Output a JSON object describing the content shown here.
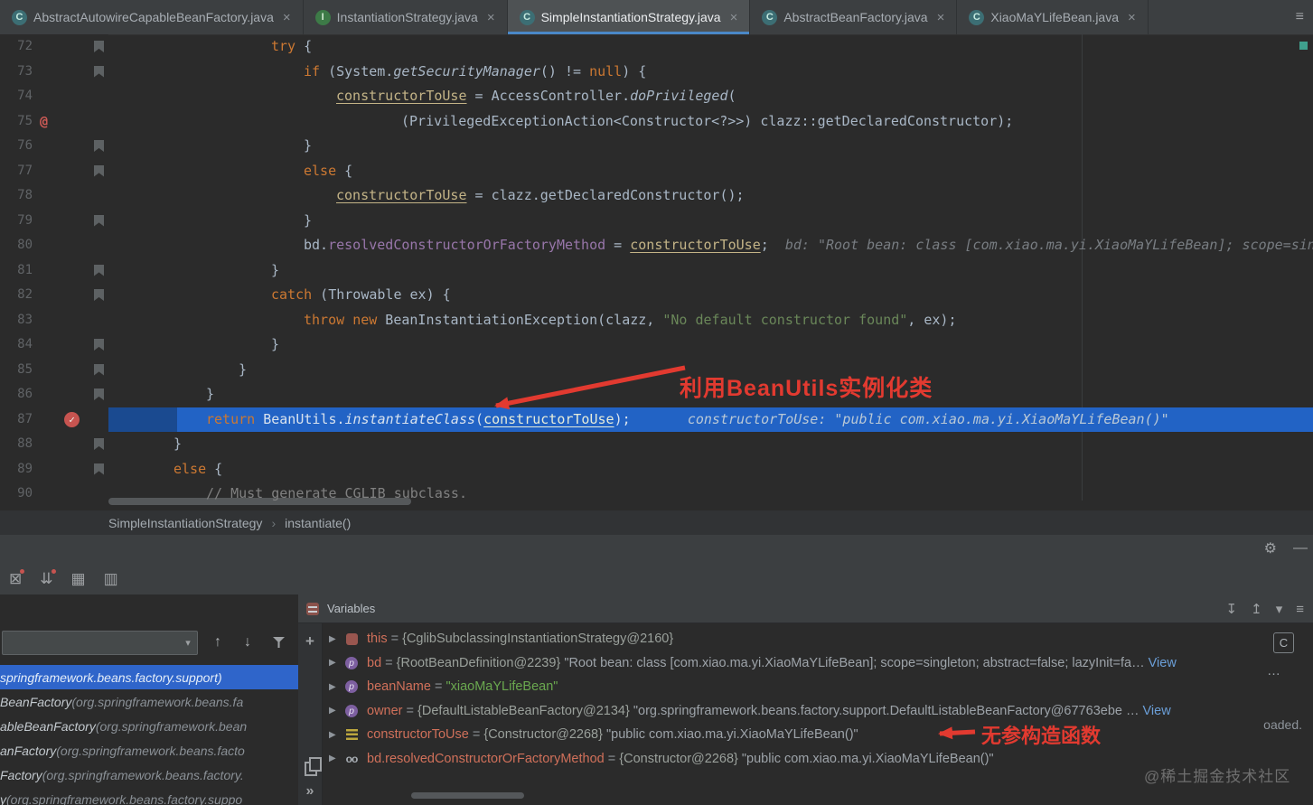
{
  "icons": {
    "overflow": "≡",
    "dropdown": "▾",
    "close": "×",
    "check": "✓",
    "at": "@",
    "gear": "⚙",
    "minus": "—",
    "plus": "+",
    "chevrons": "»",
    "up": "↑",
    "down": "↓",
    "triangle": "▶"
  },
  "tabs": {
    "items": [
      {
        "label": "AbstractAutowireCapableBeanFactory.java",
        "icon": "C",
        "kind": "class",
        "active": false
      },
      {
        "label": "InstantiationStrategy.java",
        "icon": "I",
        "kind": "interface",
        "active": false
      },
      {
        "label": "SimpleInstantiationStrategy.java",
        "icon": "C",
        "kind": "class",
        "active": true
      },
      {
        "label": "AbstractBeanFactory.java",
        "icon": "C",
        "kind": "class",
        "active": false
      },
      {
        "label": "XiaoMaYLifeBean.java",
        "icon": "C",
        "kind": "class",
        "active": false
      }
    ]
  },
  "editor": {
    "current_line": 87,
    "lines": [
      {
        "no": 72,
        "ind": 5,
        "g": "bm",
        "seg": [
          [
            "kw",
            "try"
          ],
          [
            "pl",
            " {"
          ]
        ]
      },
      {
        "no": 73,
        "ind": 6,
        "g": "bm",
        "seg": [
          [
            "kw",
            "if"
          ],
          [
            "pl",
            " (System."
          ],
          [
            "it",
            "getSecurityManager"
          ],
          [
            "pl",
            "() != "
          ],
          [
            "kw",
            "null"
          ],
          [
            "pl",
            ") {"
          ]
        ]
      },
      {
        "no": 74,
        "ind": 7,
        "g": "",
        "seg": [
          [
            "un",
            "constructorToUse"
          ],
          [
            "pl",
            " = AccessController."
          ],
          [
            "it",
            "doPrivileged"
          ],
          [
            "pl",
            "("
          ]
        ]
      },
      {
        "no": 75,
        "ind": 9,
        "g": "at",
        "seg": [
          [
            "pl",
            "(PrivilegedExceptionAction<Constructor<?>>) clazz::getDeclaredConstructor);"
          ]
        ]
      },
      {
        "no": 76,
        "ind": 6,
        "g": "bm",
        "seg": [
          [
            "pl",
            "}"
          ]
        ]
      },
      {
        "no": 77,
        "ind": 6,
        "g": "bm",
        "seg": [
          [
            "kw",
            "else"
          ],
          [
            "pl",
            " {"
          ]
        ]
      },
      {
        "no": 78,
        "ind": 7,
        "g": "",
        "seg": [
          [
            "un",
            "constructorToUse"
          ],
          [
            "pl",
            " = clazz.getDeclaredConstructor();"
          ]
        ]
      },
      {
        "no": 79,
        "ind": 6,
        "g": "bm",
        "seg": [
          [
            "pl",
            "}"
          ]
        ]
      },
      {
        "no": 80,
        "ind": 6,
        "g": "",
        "seg": [
          [
            "pl",
            "bd."
          ],
          [
            "fld",
            "resolvedConstructorOrFactoryMethod"
          ],
          [
            "pl",
            " = "
          ],
          [
            "un",
            "constructorToUse"
          ],
          [
            "pl",
            ";"
          ],
          [
            "hint",
            "  bd: \"Root bean: class [com.xiao.ma.yi.XiaoMaYLifeBean]; scope=sin"
          ]
        ]
      },
      {
        "no": 81,
        "ind": 5,
        "g": "bm",
        "seg": [
          [
            "pl",
            "}"
          ]
        ]
      },
      {
        "no": 82,
        "ind": 5,
        "g": "bm",
        "seg": [
          [
            "kw",
            "catch"
          ],
          [
            "pl",
            " (Throwable ex) {"
          ]
        ]
      },
      {
        "no": 83,
        "ind": 6,
        "g": "",
        "seg": [
          [
            "kw",
            "throw"
          ],
          [
            "pl",
            " "
          ],
          [
            "kw",
            "new"
          ],
          [
            "pl",
            " BeanInstantiationException(clazz, "
          ],
          [
            "str",
            "\"No default constructor found\""
          ],
          [
            "pl",
            ", ex);"
          ]
        ]
      },
      {
        "no": 84,
        "ind": 5,
        "g": "bm",
        "seg": [
          [
            "pl",
            "}"
          ]
        ]
      },
      {
        "no": 85,
        "ind": 4,
        "g": "bm",
        "seg": [
          [
            "pl",
            "}"
          ]
        ]
      },
      {
        "no": 86,
        "ind": 3,
        "g": "bm",
        "seg": [
          [
            "pl",
            "}"
          ]
        ]
      },
      {
        "no": 87,
        "ind": 3,
        "g": "bp",
        "seg": [
          [
            "kw",
            "return"
          ],
          [
            "pl",
            " BeanUtils."
          ],
          [
            "it",
            "instantiateClass"
          ],
          [
            "pl",
            "("
          ],
          [
            "un",
            "constructorToUse"
          ],
          [
            "pl",
            ");"
          ],
          [
            "hint2",
            "       constructorToUse: \"public com.xiao.ma.yi.XiaoMaYLifeBean()\""
          ]
        ]
      },
      {
        "no": 88,
        "ind": 2,
        "g": "bm",
        "seg": [
          [
            "pl",
            "}"
          ]
        ]
      },
      {
        "no": 89,
        "ind": 2,
        "g": "bm",
        "seg": [
          [
            "kw",
            "else"
          ],
          [
            "pl",
            " {"
          ]
        ]
      },
      {
        "no": 90,
        "ind": 3,
        "g": "",
        "seg": [
          [
            "cmt",
            "// Must generate CGLIB subclass."
          ]
        ]
      }
    ],
    "breadcrumb": {
      "items": [
        "SimpleInstantiationStrategy",
        "instantiate()"
      ],
      "separator": "›"
    }
  },
  "debug": {
    "toolbar_icons": [
      {
        "name": "close-tab-icon",
        "glyph": "⊠",
        "red": true
      },
      {
        "name": "step-filter-icon",
        "glyph": "⇊",
        "red": true
      },
      {
        "name": "view-as-table-icon",
        "glyph": "▦",
        "red": false
      },
      {
        "name": "layout-settings-icon",
        "glyph": "▥",
        "red": false
      }
    ]
  },
  "frames": {
    "combo_value": "",
    "rows": [
      {
        "sel": true,
        "head": "",
        "pkg": "springframework.beans.factory.support)"
      },
      {
        "sel": false,
        "head": "BeanFactory ",
        "pkg": "(org.springframework.beans.fa"
      },
      {
        "sel": false,
        "head": "ableBeanFactory ",
        "pkg": "(org.springframework.bean"
      },
      {
        "sel": false,
        "head": "anFactory ",
        "pkg": "(org.springframework.beans.facto"
      },
      {
        "sel": false,
        "head": "Factory ",
        "pkg": "(org.springframework.beans.factory."
      },
      {
        "sel": false,
        "head": "y ",
        "pkg": "(org.springframework.beans.factory.suppo"
      }
    ]
  },
  "variables": {
    "title": "Variables",
    "header_icons": [
      {
        "name": "scroll-to-end-icon",
        "glyph": "↧"
      },
      {
        "name": "jump-to-source-icon",
        "glyph": "↥"
      },
      {
        "name": "menu-arrow-icon",
        "glyph": "▾"
      },
      {
        "name": "menu-icon",
        "glyph": "≡"
      }
    ],
    "rows": [
      {
        "icon": "object",
        "seg": [
          [
            "vn",
            "this"
          ],
          [
            "eq",
            " = "
          ],
          [
            "ref",
            "{CglibSubclassingInstantiationStrategy@2160}"
          ]
        ]
      },
      {
        "icon": "param",
        "seg": [
          [
            "vn",
            "bd"
          ],
          [
            "eq",
            " = "
          ],
          [
            "ref",
            "{RootBeanDefinition@2239} "
          ],
          [
            "gs",
            "\"Root bean: class [com.xiao.ma.yi.XiaoMaYLifeBean]; scope=singleton; abstract=false; lazyInit=fa"
          ],
          [
            "ell",
            "… "
          ],
          [
            "view",
            "View"
          ]
        ]
      },
      {
        "icon": "param",
        "seg": [
          [
            "vn",
            "beanName"
          ],
          [
            "eq",
            " = "
          ],
          [
            "vstr",
            "\"xiaoMaYLifeBean\""
          ]
        ]
      },
      {
        "icon": "param",
        "seg": [
          [
            "vn",
            "owner"
          ],
          [
            "eq",
            " = "
          ],
          [
            "ref",
            "{DefaultListableBeanFactory@2134} "
          ],
          [
            "gs",
            "\"org.springframework.beans.factory.support.DefaultListableBeanFactory@67763ebe "
          ],
          [
            "ell",
            "… "
          ],
          [
            "view",
            "View"
          ]
        ]
      },
      {
        "icon": "local",
        "seg": [
          [
            "vn",
            "constructorToUse"
          ],
          [
            "eq",
            " = "
          ],
          [
            "ref",
            "{Constructor@2268} "
          ],
          [
            "gs",
            "\"public com.xiao.ma.yi.XiaoMaYLifeBean()\""
          ]
        ]
      },
      {
        "icon": "watch",
        "seg": [
          [
            "vn",
            "bd.resolvedConstructorOrFactoryMethod"
          ],
          [
            "eq",
            " = "
          ],
          [
            "ref",
            "{Constructor@2268} "
          ],
          [
            "gs",
            "\"public com.xiao.ma.yi.XiaoMaYLifeBean()\""
          ]
        ]
      }
    ]
  },
  "extras": {
    "eval_c": "C",
    "dots": "…",
    "loaded": "oaded."
  },
  "annotations": {
    "main": "利用BeanUtils实例化类",
    "secondary": "无参构造函数"
  },
  "watermark": "@稀土掘金技术社区"
}
